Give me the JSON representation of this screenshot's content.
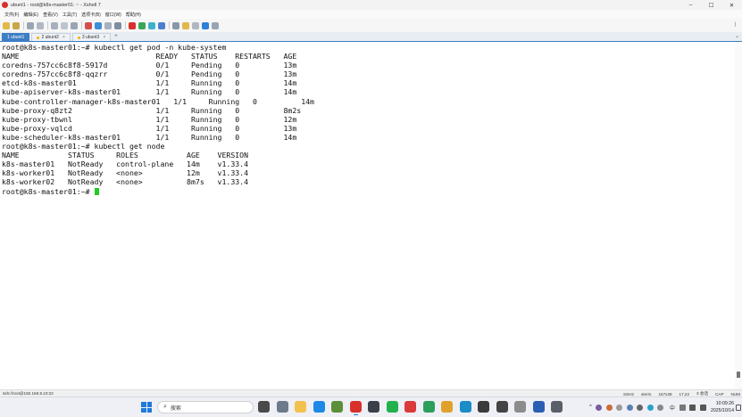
{
  "window": {
    "title": "ubunt1 - root@k8s-master01: ~ - Xshell 7",
    "controls": [
      "–",
      "☐",
      "✕"
    ]
  },
  "menu": [
    "文件(F)",
    "编辑(E)",
    "查看(V)",
    "工具(T)",
    "选项卡(B)",
    "窗口(W)",
    "帮助(H)"
  ],
  "tabs": [
    {
      "label": "1 ubunt1",
      "active": true
    },
    {
      "label": "2 ubunt2",
      "active": false
    },
    {
      "label": "3 ubunt3",
      "active": false
    }
  ],
  "terminal": {
    "lines": [
      "root@k8s-master01:~# kubectl get pod -n kube-system",
      "NAME                               READY   STATUS    RESTARTS   AGE",
      "coredns-757cc6c8f8-5917d           0/1     Pending   0          13m",
      "coredns-757cc6c8f8-qqzrr           0/1     Pending   0          13m",
      "etcd-k8s-master01                  1/1     Running   0          14m",
      "kube-apiserver-k8s-master01        1/1     Running   0          14m",
      "kube-controller-manager-k8s-master01   1/1     Running   0          14m",
      "kube-proxy-q8zt2                   1/1     Running   0          8m2s",
      "kube-proxy-tbwnl                   1/1     Running   0          12m",
      "kube-proxy-vqlcd                   1/1     Running   0          13m",
      "kube-scheduler-k8s-master01        1/1     Running   0          14m",
      "root@k8s-master01:~# kubectl get node",
      "NAME           STATUS     ROLES           AGE    VERSION",
      "k8s-master01   NotReady   control-plane   14m    v1.33.4",
      "k8s-worker01   NotReady   <none>          12m    v1.33.4",
      "k8s-worker02   NotReady   <none>          8m7s   v1.33.4"
    ],
    "prompt": "root@k8s-master01:~# ",
    "cursor_color": "#22cc22"
  },
  "status": {
    "connection": "ssh://root@192.168.8.10:22",
    "items": [
      "SSH2",
      "xterm",
      "157x38",
      "17,22",
      "3 会话",
      "CAP",
      "NUM"
    ]
  },
  "taskbar": {
    "search_label": "搜索",
    "apps": [
      {
        "name": "task-view-icon",
        "color": "#4a4a4a",
        "active": false
      },
      {
        "name": "settings-icon",
        "color": "#6d7a8c",
        "active": false
      },
      {
        "name": "file-explorer-icon",
        "color": "#f2c14e",
        "active": false
      },
      {
        "name": "vscode-icon",
        "color": "#1e88e5",
        "active": false
      },
      {
        "name": "terminal-icon",
        "color": "#5c8f3a",
        "active": false
      },
      {
        "name": "xshell-icon",
        "color": "#d8302b",
        "active": true
      },
      {
        "name": "monitor-icon",
        "color": "#3a3f4a",
        "active": false
      },
      {
        "name": "chat-icon",
        "color": "#22b14c",
        "active": false
      },
      {
        "name": "wps-icon",
        "color": "#d93a3a",
        "active": false
      },
      {
        "name": "green-app-icon",
        "color": "#2e9e5b",
        "active": false
      },
      {
        "name": "chrome-icon",
        "color": "#e0a12c",
        "active": false
      },
      {
        "name": "edge-icon",
        "color": "#1a8cc8",
        "active": false
      },
      {
        "name": "dark-app-icon",
        "color": "#3b3b3b",
        "active": false
      },
      {
        "name": "cube-app-icon",
        "color": "#444444",
        "active": false
      },
      {
        "name": "mouse-app-icon",
        "color": "#8c8c8c",
        "active": false
      },
      {
        "name": "word-icon",
        "color": "#2b5fb4",
        "active": false
      },
      {
        "name": "vm-app-icon",
        "color": "#5a5f6a",
        "active": false
      }
    ],
    "language": "中",
    "time": "10:09:26",
    "date": "2025/10/14"
  }
}
